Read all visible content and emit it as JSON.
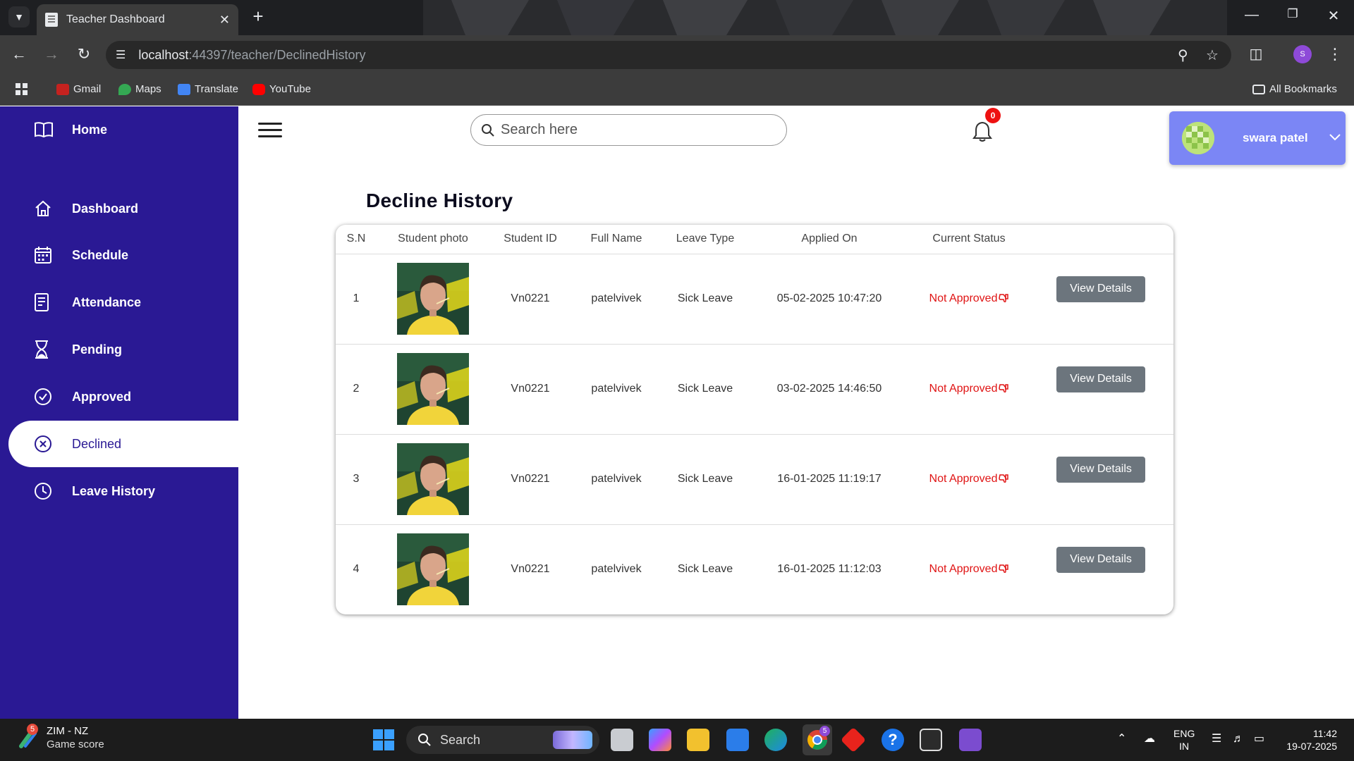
{
  "browser": {
    "tab_title": "Teacher Dashboard",
    "url_host": "localhost",
    "url_rest": ":44397/teacher/DeclinedHistory",
    "profile_initial": "S",
    "bookmarks": [
      "Gmail",
      "Maps",
      "Translate",
      "YouTube"
    ],
    "all_bookmarks": "All Bookmarks"
  },
  "sidebar": {
    "items": [
      {
        "label": "Home",
        "icon": "book-icon"
      },
      {
        "label": "Dashboard",
        "icon": "house-icon"
      },
      {
        "label": "Schedule",
        "icon": "calendar-icon"
      },
      {
        "label": "Attendance",
        "icon": "document-icon"
      },
      {
        "label": "Pending",
        "icon": "hourglass-icon"
      },
      {
        "label": "Approved",
        "icon": "check-circle-icon"
      },
      {
        "label": "Declined",
        "icon": "x-circle-icon"
      },
      {
        "label": "Leave History",
        "icon": "clock-icon"
      }
    ],
    "active": "Declined"
  },
  "header": {
    "search_placeholder": "Search here",
    "notification_count": "0",
    "user_name": "swara patel"
  },
  "page": {
    "title": "Decline History"
  },
  "table": {
    "columns": [
      "S.N",
      "Student photo",
      "Student ID",
      "Full Name",
      "Leave Type",
      "Applied On",
      "Current Status",
      ""
    ],
    "rows": [
      {
        "sn": "1",
        "student_id": "Vn0221",
        "full_name": "patelvivek",
        "leave_type": "Sick Leave",
        "applied_on": "05-02-2025 10:47:20",
        "status": "Not Approved",
        "action": "View Details"
      },
      {
        "sn": "2",
        "student_id": "Vn0221",
        "full_name": "patelvivek",
        "leave_type": "Sick Leave",
        "applied_on": "03-02-2025 14:46:50",
        "status": "Not Approved",
        "action": "View Details"
      },
      {
        "sn": "3",
        "student_id": "Vn0221",
        "full_name": "patelvivek",
        "leave_type": "Sick Leave",
        "applied_on": "16-01-2025 11:19:17",
        "status": "Not Approved",
        "action": "View Details"
      },
      {
        "sn": "4",
        "student_id": "Vn0221",
        "full_name": "patelvivek",
        "leave_type": "Sick Leave",
        "applied_on": "16-01-2025 11:12:03",
        "status": "Not Approved",
        "action": "View Details"
      }
    ]
  },
  "taskbar": {
    "widget_badge": "5",
    "widget_title": "ZIM - NZ",
    "widget_subtitle": "Game score",
    "search_label": "Search",
    "chrome_badge": "5",
    "lang_top": "ENG",
    "lang_bottom": "IN",
    "time": "11:42",
    "date": "19-07-2025"
  },
  "colors": {
    "sidebar": "#2a1994",
    "user_card": "#7b86f5",
    "status_declined": "#e01414",
    "button": "#6c757d"
  }
}
